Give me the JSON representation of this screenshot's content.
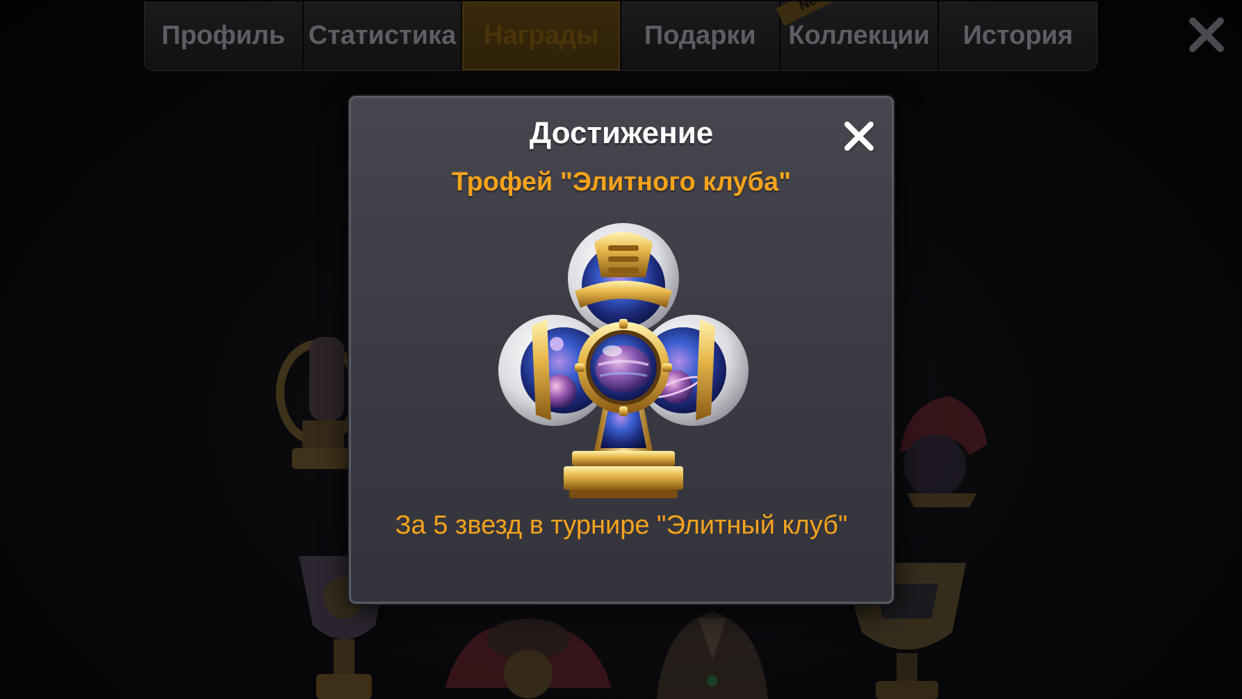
{
  "tabs": [
    {
      "label": "Профиль",
      "active": false
    },
    {
      "label": "Статистика",
      "active": false
    },
    {
      "label": "Награды",
      "active": true
    },
    {
      "label": "Подарки",
      "active": false
    },
    {
      "label": "Коллекции",
      "active": false,
      "badge": "New"
    },
    {
      "label": "История",
      "active": false
    }
  ],
  "dialog": {
    "title": "Достижение",
    "trophy_name": "Трофей \"Элитного клуба\"",
    "description": "За 5 звезд в турнире \"Элитный клуб\""
  },
  "icons": {
    "screen_close": "close-icon",
    "dialog_close": "close-icon",
    "trophy": "club-suit-space-trophy"
  },
  "colors": {
    "accent_orange": "#f6a31c",
    "active_tab": "#3a2a0c",
    "modal_bg": "#3e3e47"
  }
}
